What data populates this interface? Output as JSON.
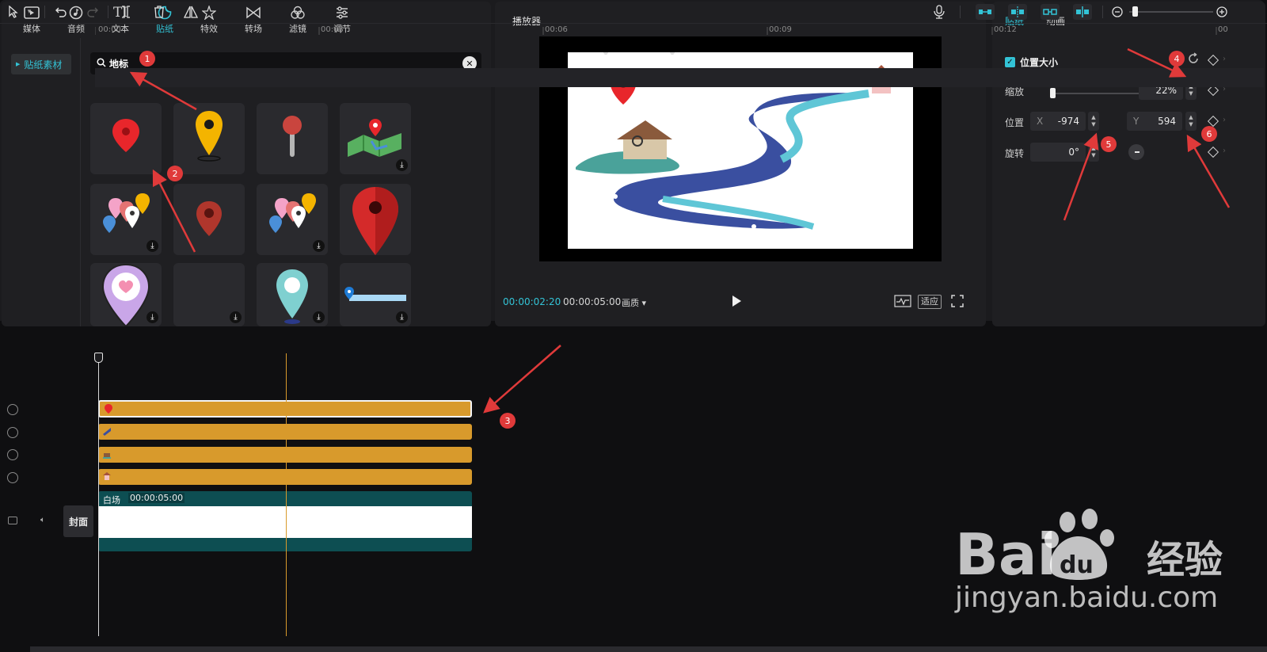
{
  "top_tabs": [
    {
      "label": "媒体",
      "icon": "media-icon"
    },
    {
      "label": "音频",
      "icon": "audio-icon"
    },
    {
      "label": "文本",
      "icon": "text-icon"
    },
    {
      "label": "贴纸",
      "icon": "sticker-icon",
      "active": true
    },
    {
      "label": "特效",
      "icon": "effects-icon"
    },
    {
      "label": "转场",
      "icon": "transition-icon"
    },
    {
      "label": "滤镜",
      "icon": "filter-icon"
    },
    {
      "label": "调节",
      "icon": "adjust-icon"
    }
  ],
  "side_nav": {
    "item": "贴纸素材"
  },
  "search": {
    "value": "地标"
  },
  "stickers": [
    {
      "name": "red-map-pin",
      "download": false
    },
    {
      "name": "yellow-map-pin",
      "download": false
    },
    {
      "name": "push-pin",
      "download": false
    },
    {
      "name": "map-with-pin",
      "download": true
    },
    {
      "name": "colorful-pins-cluster",
      "download": true
    },
    {
      "name": "dark-red-pin",
      "download": false
    },
    {
      "name": "colorful-pins-cluster-2",
      "download": true
    },
    {
      "name": "large-red-pin",
      "download": false
    },
    {
      "name": "heart-pin",
      "download": true
    },
    {
      "name": "empty-sticker",
      "download": true
    },
    {
      "name": "teal-pin",
      "download": true
    },
    {
      "name": "blue-pin-route",
      "download": true
    }
  ],
  "player": {
    "title": "播放器",
    "current_time": "00:00:02:20",
    "total_time": "00:00:05:00",
    "quality_label": "画质",
    "fit_label": "适应"
  },
  "props": {
    "tabs": [
      "贴纸",
      "动画"
    ],
    "section": "位置大小",
    "scale_label": "缩放",
    "scale_value": "22%",
    "scale_fraction": 0.22,
    "position_label": "位置",
    "x_axis": "X",
    "x_value": "-974",
    "y_axis": "Y",
    "y_value": "594",
    "rotation_label": "旋转",
    "rotation_value": "0°"
  },
  "timeline": {
    "ruler": [
      "00:00",
      "00:03",
      "00:06",
      "00:09",
      "00:12",
      "00"
    ],
    "main_clip_label": "白场",
    "main_clip_duration": "00:00:05:00",
    "cover_label": "封面"
  },
  "annotations": [
    "1",
    "2",
    "3",
    "4",
    "5",
    "6"
  ],
  "watermark": {
    "brand": "Bai",
    "brand2": "du",
    "brand3": "经验",
    "url": "jingyan.baidu.com"
  },
  "colors": {
    "accent": "#33c3d6",
    "clip": "#d89a2c",
    "annotation": "#e03a3a",
    "main_track": "#0d4e52"
  }
}
